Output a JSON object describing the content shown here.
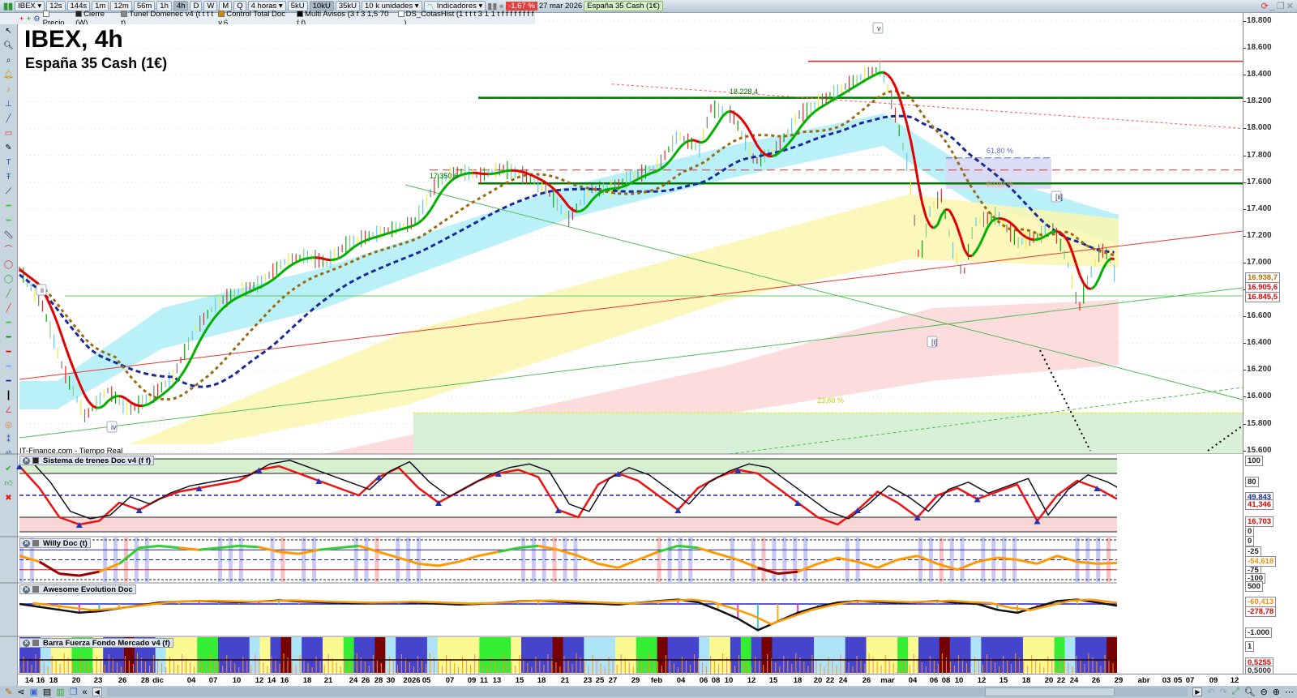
{
  "toolbar": {
    "symbol": "IBEX",
    "periods": [
      "12s",
      "144s",
      "1m",
      "12m",
      "56m",
      "1h",
      "4h",
      "D",
      "W",
      "M",
      "Q"
    ],
    "active_period": "4h",
    "period_select": "4 horas",
    "units": [
      "5kU",
      "10kU",
      "35kU"
    ],
    "active_unit": "10kU",
    "unit_select": "10 k unidades",
    "indicators": "Indicadores",
    "change": "-1,67 %",
    "date": "27 mar 2026",
    "instrument": "España 35 Cash (1€)"
  },
  "legend_bar": {
    "items": [
      "Precio",
      "Cierre (W)",
      "Tunel Domenec v4 (t t t t t)",
      "Control Total Doc v.6",
      "Multi Avisos (3 f 3 1,5 70 f f)",
      "DS_CotasHist (1 t t t 3 1 1 t f f f f f f f f ...)"
    ]
  },
  "chart": {
    "title": "IBEX, 4h",
    "subtitle": "España 35 Cash (1€)",
    "watermark": "IT-Finance.com - Tiempo Real",
    "annotations": {
      "level_high": "18.228,4",
      "level_low": "17.350,6",
      "fib_618": "61,80 %",
      "fib_50": "50,00 %",
      "fib_236": "23,60 %",
      "wave_v": "v",
      "wave_ii": "ii",
      "wave_iv": "iv",
      "wave_i_br": "[i]",
      "wave_ii_br": "[ii]"
    },
    "price_axis": [
      "18.800",
      "18.600",
      "18.400",
      "18.200",
      "18.000",
      "17.800",
      "17.600",
      "17.400",
      "17.200",
      "17.000",
      "16.800",
      "16.600",
      "16.400",
      "16.200",
      "16.000",
      "15.800",
      "15.600"
    ],
    "price_tags": [
      {
        "v": "16.938,7",
        "c": "#b07000"
      },
      {
        "v": "16.905,6",
        "c": "#e00000"
      },
      {
        "v": "16.845,5",
        "c": "#e00000"
      }
    ],
    "colors": {
      "up": "#00b000",
      "down": "#e00000",
      "ma_blue": "#1a2a9a",
      "ma_brown": "#9a6a10",
      "cyan_band": "#aeeef8",
      "yellow_band": "#fbf7b0",
      "pink_band": "#fbd6d6"
    }
  },
  "chart_data": {
    "type": "line",
    "title": "IBEX, 4h",
    "ylim": [
      15600,
      18800
    ],
    "xlim": [
      0,
      100
    ],
    "series": [
      {
        "name": "Precio",
        "points": [
          [
            0,
            16950
          ],
          [
            2,
            16700
          ],
          [
            4,
            16200
          ],
          [
            6,
            15850
          ],
          [
            8,
            16050
          ],
          [
            10,
            15900
          ],
          [
            12,
            16000
          ],
          [
            14,
            16150
          ],
          [
            16,
            16500
          ],
          [
            18,
            16700
          ],
          [
            20,
            16780
          ],
          [
            22,
            16850
          ],
          [
            24,
            17000
          ],
          [
            26,
            17050
          ],
          [
            28,
            17000
          ],
          [
            30,
            17150
          ],
          [
            32,
            17200
          ],
          [
            34,
            17250
          ],
          [
            36,
            17300
          ],
          [
            38,
            17600
          ],
          [
            40,
            17680
          ],
          [
            42,
            17650
          ],
          [
            44,
            17700
          ],
          [
            46,
            17650
          ],
          [
            48,
            17550
          ],
          [
            50,
            17320
          ],
          [
            52,
            17550
          ],
          [
            54,
            17550
          ],
          [
            56,
            17650
          ],
          [
            58,
            17700
          ],
          [
            60,
            17950
          ],
          [
            62,
            17850
          ],
          [
            63,
            18150
          ],
          [
            65,
            18100
          ],
          [
            67,
            17750
          ],
          [
            69,
            17850
          ],
          [
            71,
            18100
          ],
          [
            73,
            18200
          ],
          [
            75,
            18300
          ],
          [
            77,
            18400
          ],
          [
            78.5,
            18450
          ],
          [
            79.5,
            18200
          ],
          [
            81,
            17700
          ],
          [
            82,
            17000
          ],
          [
            83,
            17400
          ],
          [
            84,
            17500
          ],
          [
            85,
            17100
          ],
          [
            86,
            16900
          ],
          [
            87,
            17300
          ],
          [
            89,
            17350
          ],
          [
            91,
            17150
          ],
          [
            93,
            17200
          ],
          [
            94,
            17300
          ],
          [
            95.5,
            17000
          ],
          [
            96.5,
            16650
          ],
          [
            97.5,
            16900
          ],
          [
            98.5,
            17100
          ],
          [
            99.3,
            17050
          ],
          [
            100,
            16850
          ]
        ]
      }
    ]
  },
  "panels": [
    {
      "name": "Sistema de trenes Doc v4 (f f)",
      "axis": [
        "100",
        "80",
        "0"
      ],
      "tags": [
        {
          "v": "49,843",
          "c": "#1a2a9a"
        },
        {
          "v": "41,346",
          "c": "#e00000"
        },
        {
          "v": "16,703",
          "c": "#e00000"
        }
      ],
      "values": [
        90,
        60,
        20,
        10,
        15,
        40,
        30,
        45,
        55,
        60,
        65,
        70,
        85,
        90,
        80,
        70,
        60,
        50,
        75,
        88,
        60,
        40,
        55,
        70,
        80,
        85,
        75,
        30,
        20,
        65,
        80,
        70,
        50,
        30,
        60,
        75,
        85,
        80,
        60,
        40,
        20,
        10,
        30,
        55,
        40,
        20,
        50,
        60,
        45,
        55,
        65,
        15,
        50,
        70,
        60,
        45
      ]
    },
    {
      "name": "Willy Doc (t)",
      "axis": [
        "0",
        "-25",
        "-75",
        "-100"
      ],
      "tags": [
        {
          "v": "-54,618",
          "c": "#f09000"
        }
      ],
      "values": [
        -40,
        -55,
        -85,
        -90,
        -80,
        -60,
        -20,
        -15,
        -20,
        -25,
        -20,
        -15,
        -18,
        -30,
        -35,
        -25,
        -20,
        -15,
        -30,
        -45,
        -60,
        -65,
        -55,
        -40,
        -30,
        -20,
        -15,
        -25,
        -40,
        -60,
        -70,
        -50,
        -30,
        -15,
        -20,
        -35,
        -50,
        -70,
        -85,
        -80,
        -60,
        -45,
        -55,
        -70,
        -50,
        -40,
        -60,
        -75,
        -55,
        -45,
        -50,
        -60,
        -40,
        -55,
        -60,
        -58
      ]
    },
    {
      "name": "Awesome Evolution Doc",
      "axis": [
        "500",
        "-1.000"
      ],
      "tags": [
        {
          "v": "-60,413",
          "c": "#f09000"
        },
        {
          "v": "-278,78",
          "c": "#e00000"
        }
      ],
      "values": [
        0,
        -100,
        -200,
        -300,
        -250,
        -150,
        -50,
        50,
        80,
        100,
        80,
        60,
        80,
        120,
        90,
        60,
        40,
        20,
        30,
        60,
        40,
        10,
        -20,
        0,
        40,
        90,
        110,
        80,
        40,
        10,
        -20,
        40,
        100,
        150,
        60,
        -200,
        -500,
        -900,
        -600,
        -300,
        -100,
        50,
        100,
        70,
        40,
        60,
        100,
        40,
        0,
        -200,
        -300,
        -100,
        100,
        150,
        50,
        -60
      ]
    },
    {
      "name": "Barra Fuerza Fondo Mercado v4 (f)",
      "axis": [
        "1"
      ],
      "tags": [
        {
          "v": "0,5255",
          "c": "#e00000"
        },
        {
          "v": "0,5000",
          "c": "#333"
        }
      ],
      "colors": "bbcyyggybbrbbcyyyggbbbcybrcbbyygbbrcbbbcyyyygggybbbrbbcccyyggrbbbcyybgbrbbbbcccbbyyygybbrbbcbbbbyyygcbbbr"
    }
  ],
  "date_axis": [
    "14",
    "16",
    "18",
    "20",
    "23",
    "26",
    "28",
    "dic",
    "04",
    "07",
    "10",
    "12",
    "14",
    "16",
    "18",
    "21",
    "24",
    "26",
    "28",
    "30",
    "2026",
    "05",
    "07",
    "09",
    "11",
    "13",
    "15",
    "18",
    "21",
    "23",
    "25",
    "27",
    "29",
    "feb",
    "04",
    "06",
    "08",
    "10",
    "12",
    "15",
    "18",
    "20",
    "22",
    "24",
    "26",
    "mar",
    "04",
    "06",
    "08",
    "10",
    "12",
    "15",
    "18",
    "20",
    "22",
    "24",
    "26",
    "29",
    "abr",
    "03",
    "05",
    "07",
    "09",
    "12"
  ]
}
